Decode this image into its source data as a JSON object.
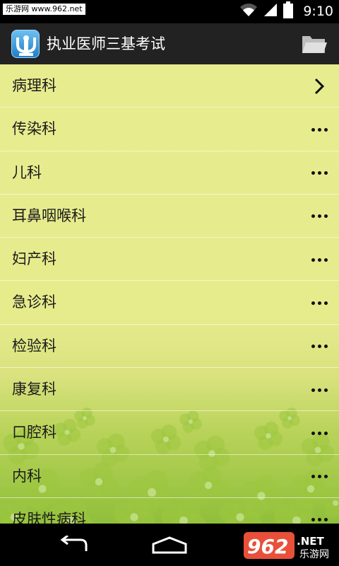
{
  "status_bar": {
    "watermark": "乐游网 www.962.net",
    "time": "9:10",
    "icons": [
      "wifi-icon",
      "signal-icon",
      "battery-icon"
    ]
  },
  "action_bar": {
    "title": "执业医师三基考试",
    "logo_icon": "app-logo-icon",
    "folder_icon": "folder-icon"
  },
  "list": {
    "items": [
      {
        "label": "病理科",
        "action": "chevron-right-icon"
      },
      {
        "label": "传染科",
        "action": "more-dots-icon"
      },
      {
        "label": "儿科",
        "action": "more-dots-icon"
      },
      {
        "label": "耳鼻咽喉科",
        "action": "more-dots-icon"
      },
      {
        "label": "妇产科",
        "action": "more-dots-icon"
      },
      {
        "label": "急诊科",
        "action": "more-dots-icon"
      },
      {
        "label": "检验科",
        "action": "more-dots-icon"
      },
      {
        "label": "康复科",
        "action": "more-dots-icon"
      },
      {
        "label": "口腔科",
        "action": "more-dots-icon"
      },
      {
        "label": "内科",
        "action": "more-dots-icon"
      },
      {
        "label": "皮肤性病科",
        "action": "more-dots-icon"
      }
    ]
  },
  "nav_bar": {
    "icons": [
      "back-icon",
      "home-icon"
    ],
    "watermark_logo": {
      "number": "962",
      "suffix": ".NET",
      "cn": "乐游网"
    }
  },
  "colors": {
    "list_background": "#e7ec8f",
    "action_bar": "#222222",
    "clover": "#9cc73f"
  }
}
